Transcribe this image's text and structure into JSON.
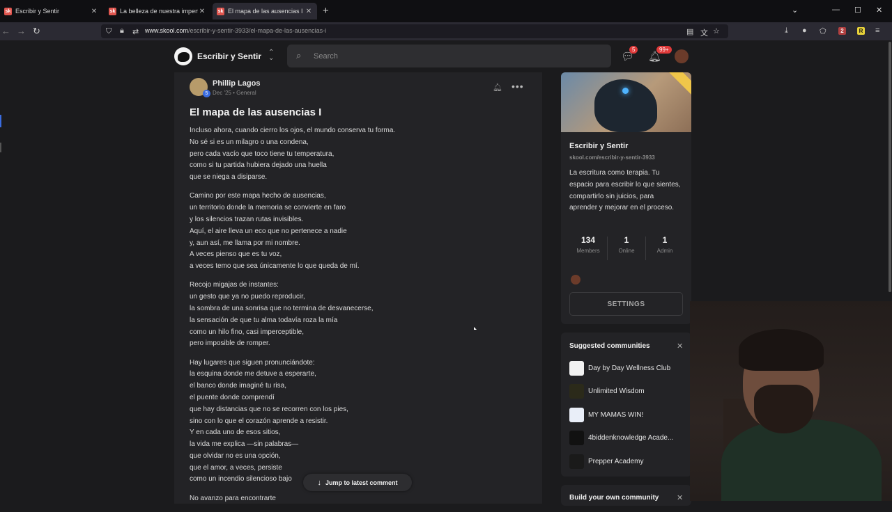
{
  "browser": {
    "tabs": [
      {
        "favicon": "sk",
        "title": "Escribir y Sentir",
        "active": false
      },
      {
        "favicon": "sk",
        "title": "La belleza de nuestra imperfecc",
        "active": false
      },
      {
        "favicon": "sk",
        "title": "El mapa de las ausencias I - Escr",
        "active": true
      }
    ],
    "url_host": "www.skool.com",
    "url_path": "/escribir-y-sentir-3933/el-mapa-de-las-ausencias-i",
    "extension_badge": "2"
  },
  "header": {
    "brand_name": "Escribir y Sentir",
    "search_placeholder": "Search",
    "chat_badge": "5",
    "notif_badge": "99+"
  },
  "post": {
    "author_name": "Phillip Lagos",
    "author_level": "5",
    "date": "Dec '25",
    "meta_separator": "•",
    "category": "General",
    "title": "El mapa de las ausencias I",
    "stanzas": [
      [
        "Incluso ahora, cuando cierro los ojos, el mundo conserva tu forma.",
        "No sé si es un milagro o una condena,",
        "pero cada vacío que toco tiene tu temperatura,",
        "como si tu partida hubiera dejado una huella",
        "que se niega a disiparse."
      ],
      [
        "Camino por este mapa hecho de ausencias,",
        "un territorio donde la memoria se convierte en faro",
        "y los silencios trazan rutas invisibles.",
        "Aquí, el aire lleva un eco que no pertenece a nadie",
        "y, aun así, me llama por mi nombre.",
        "A veces pienso que es tu voz,",
        "a veces temo que sea únicamente lo que queda de mí."
      ],
      [
        "Recojo migajas de instantes:",
        "un gesto que ya no puedo reproducir,",
        "la sombra de una sonrisa que no termina de desvanecerse,",
        "la sensación de que tu alma todavía roza la mía",
        "como un hilo fino, casi imperceptible,",
        "pero imposible de romper."
      ],
      [
        "Hay lugares que siguen pronunciándote:",
        "la esquina donde me detuve a esperarte,",
        "el banco donde imaginé tu risa,",
        "el puente donde comprendí",
        "que hay distancias que no se recorren con los pies,",
        "sino con lo que el corazón aprende a resistir.",
        "Y en cada uno de esos sitios,",
        "la vida me explica —sin palabras—",
        "que olvidar no es una opción,",
        "que el amor, a veces, persiste",
        "como un incendio silencioso bajo"
      ],
      [
        "No avanzo para encontrarte"
      ]
    ],
    "jump_label": "Jump to latest comment"
  },
  "group": {
    "name": "Escribir y Sentir",
    "url": "skool.com/escribir-y-sentir-3933",
    "description": "La escritura como terapia. Tu espacio para escribir lo que sientes, compartirlo sin juicios, para aprender y mejorar en el proceso.",
    "stats": [
      {
        "value": "134",
        "label": "Members"
      },
      {
        "value": "1",
        "label": "Online"
      },
      {
        "value": "1",
        "label": "Admin"
      }
    ],
    "settings_label": "SETTINGS"
  },
  "suggested": {
    "title": "Suggested communities",
    "items": [
      {
        "name": "Day by Day Wellness Club",
        "icon_bg": "#f2f2f2"
      },
      {
        "name": "Unlimited Wisdom",
        "icon_bg": "#2b2a1a"
      },
      {
        "name": "MY MAMAS WIN!",
        "icon_bg": "#e9eef8"
      },
      {
        "name": "4biddenknowledge Acade...",
        "icon_bg": "#111111"
      },
      {
        "name": "Prepper Academy",
        "icon_bg": "#1a1a1a"
      }
    ]
  },
  "build": {
    "title": "Build your own community"
  }
}
